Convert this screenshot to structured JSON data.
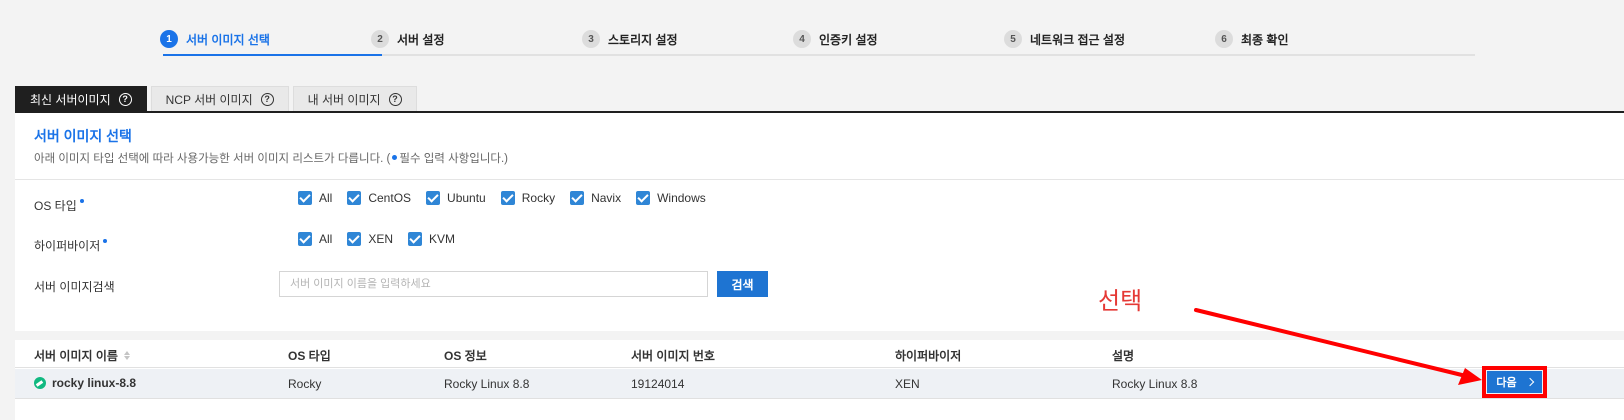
{
  "steps": [
    {
      "num": "1",
      "label": "서버 이미지 선택",
      "active": true
    },
    {
      "num": "2",
      "label": "서버 설정"
    },
    {
      "num": "3",
      "label": "스토리지 설정"
    },
    {
      "num": "4",
      "label": "인증키 설정"
    },
    {
      "num": "5",
      "label": "네트워크 접근 설정"
    },
    {
      "num": "6",
      "label": "최종 확인"
    }
  ],
  "tabs": [
    {
      "label": "최신 서버이미지",
      "active": true
    },
    {
      "label": "NCP 서버 이미지"
    },
    {
      "label": "내 서버 이미지"
    }
  ],
  "panel": {
    "title": "서버 이미지 선택",
    "desc_before": "아래 이미지 타입 선택에 따라 사용가능한 서버 이미지 리스트가 다릅니다. (",
    "desc_after": "필수 입력 사항입니다.)"
  },
  "filters": {
    "os_label": "OS 타입",
    "os_options": [
      "All",
      "CentOS",
      "Ubuntu",
      "Rocky",
      "Navix",
      "Windows"
    ],
    "hv_label": "하이퍼바이저",
    "hv_options": [
      "All",
      "XEN",
      "KVM"
    ],
    "search_label": "서버 이미지검색",
    "search_placeholder": "서버 이미지 이름을 입력하세요",
    "search_button": "검색"
  },
  "annotation": {
    "text": "선택",
    "color": "#e53935"
  },
  "table": {
    "headers": [
      "서버 이미지 이름",
      "OS 타입",
      "OS 정보",
      "서버 이미지 번호",
      "하이퍼바이저",
      "설명"
    ],
    "rows": [
      {
        "name": "rocky linux-8.8",
        "os_type": "Rocky",
        "os_info": "Rocky Linux 8.8",
        "image_no": "19124014",
        "hypervisor": "XEN",
        "desc": "Rocky Linux 8.8",
        "action": "다음"
      }
    ]
  },
  "colors": {
    "accent": "#1a73e8",
    "button": "#1e74d2",
    "highlight": "#ff0000"
  }
}
